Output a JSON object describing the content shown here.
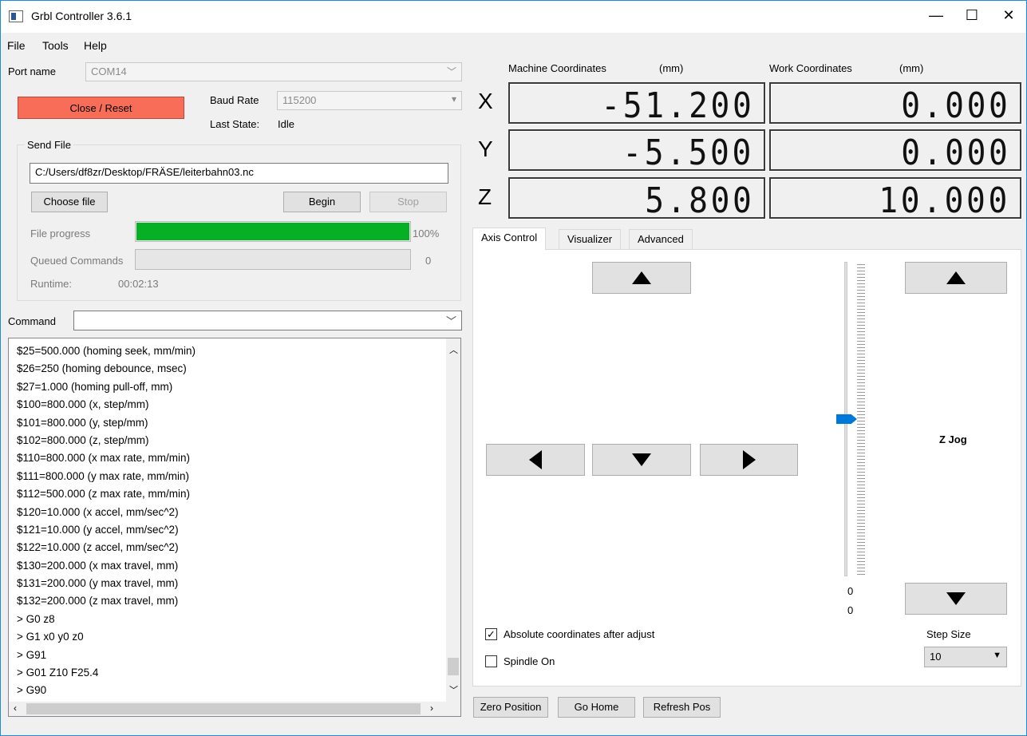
{
  "window": {
    "title": "Grbl Controller 3.6.1",
    "controls": {
      "minimize": "—",
      "maximize": "☐",
      "close": "✕"
    }
  },
  "menu": [
    "File",
    "Tools",
    "Help"
  ],
  "connection": {
    "port_label": "Port name",
    "port_value": "COM14",
    "close_reset_label": "Close / Reset",
    "baud_label": "Baud Rate",
    "baud_value": "115200",
    "last_state_label": "Last State:",
    "last_state_value": "Idle"
  },
  "send_file": {
    "group_title": "Send File",
    "path": "C:/Users/df8zr/Desktop/FRÄSE/leiterbahn03.nc",
    "choose_label": "Choose file",
    "begin_label": "Begin",
    "stop_label": "Stop",
    "file_progress_label": "File progress",
    "file_progress_value": 1.0,
    "file_progress_text": "100%",
    "queued_label": "Queued Commands",
    "queued_value": "0",
    "runtime_label": "Runtime:",
    "runtime_value": "00:02:13"
  },
  "command": {
    "label": "Command",
    "value": ""
  },
  "console": {
    "lines": [
      "$25=500.000 (homing seek, mm/min)",
      "$26=250 (homing debounce, msec)",
      "$27=1.000 (homing pull-off, mm)",
      "$100=800.000 (x, step/mm)",
      "$101=800.000 (y, step/mm)",
      "$102=800.000 (z, step/mm)",
      "$110=800.000 (x max rate, mm/min)",
      "$111=800.000 (y max rate, mm/min)",
      "$112=500.000 (z max rate, mm/min)",
      "$120=10.000 (x accel, mm/sec^2)",
      "$121=10.000 (y accel, mm/sec^2)",
      "$122=10.000 (z accel, mm/sec^2)",
      "$130=200.000 (x max travel, mm)",
      "$131=200.000 (y max travel, mm)",
      "$132=200.000 (z max travel, mm)",
      "> G0 z8",
      "> G1 x0 y0 z0",
      "> G91",
      "> G01 Z10 F25.4",
      "> G90"
    ]
  },
  "coordinates": {
    "machine_label": "Machine Coordinates",
    "machine_unit": "(mm)",
    "work_label": "Work Coordinates",
    "work_unit": "(mm)",
    "axes": [
      {
        "axis": "X",
        "machine": "-51.200",
        "work": "0.000"
      },
      {
        "axis": "Y",
        "machine": "-5.500",
        "work": "0.000"
      },
      {
        "axis": "Z",
        "machine": "5.800",
        "work": "10.000"
      }
    ]
  },
  "tabs": [
    "Axis Control",
    "Visualizer",
    "Advanced"
  ],
  "axis_control": {
    "z_jog_label": "Z Jog",
    "slider_value_1": "0",
    "slider_value_2": "0",
    "absolute_coords_label": "Absolute coordinates after adjust",
    "absolute_coords_checked": true,
    "spindle_label": "Spindle On",
    "spindle_checked": false,
    "step_size_label": "Step Size",
    "step_size_value": "10",
    "check_mark": "✓"
  },
  "bottom_buttons": {
    "zero_position": "Zero Position",
    "go_home": "Go Home",
    "refresh_pos": "Refresh Pos"
  },
  "colors": {
    "close_reset_bg": "#f76d57",
    "progress_green": "#06b025",
    "slider_handle": "#0078d7"
  }
}
